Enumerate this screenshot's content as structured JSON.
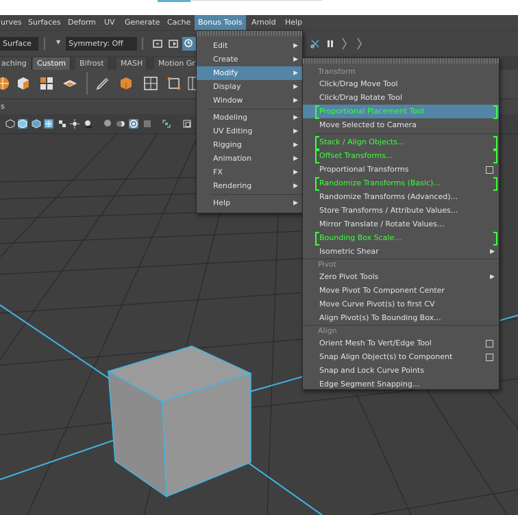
{
  "menubar": {
    "items": [
      "urves",
      "Surfaces",
      "Deform",
      "UV",
      "Generate",
      "Cache",
      "Bonus Tools",
      "Arnold",
      "Help"
    ],
    "active": "Bonus Tools"
  },
  "toolbar": {
    "surface_label": "Surface",
    "symmetry_label": "Symmetry: Off"
  },
  "shelf_tabs": [
    "aching",
    "Custom",
    "Bifrost",
    "MASH",
    "Motion Gr"
  ],
  "panel_label": "ls",
  "bonus_menu": {
    "items": [
      {
        "label": "Edit",
        "submenu": true
      },
      {
        "label": "Create",
        "submenu": true
      },
      {
        "label": "Modify",
        "submenu": true,
        "selected": true
      },
      {
        "label": "Display",
        "submenu": true
      },
      {
        "label": "Window",
        "submenu": true
      },
      {
        "label": "Modeling",
        "submenu": true
      },
      {
        "label": "UV Editing",
        "submenu": true
      },
      {
        "label": "Rigging",
        "submenu": true
      },
      {
        "label": "Animation",
        "submenu": true
      },
      {
        "label": "FX",
        "submenu": true
      },
      {
        "label": "Rendering",
        "submenu": true
      },
      {
        "label": "Help",
        "submenu": true
      }
    ]
  },
  "modify_menu": {
    "sections": {
      "transform": "Transform",
      "pivot": "Pivot",
      "align": "Align"
    },
    "transform_items": [
      {
        "label": "Click/Drag Move Tool"
      },
      {
        "label": "Click/Drag Rotate Tool"
      },
      {
        "label": "Proportional Placement Tool",
        "marked": true,
        "highlighted": true
      },
      {
        "label": "Move Selected to Camera"
      },
      {
        "label": "Stack / Align Objects...",
        "marked": true
      },
      {
        "label": "Offset Transforms...",
        "marked": true
      },
      {
        "label": "Proportional Transforms",
        "option_box": true
      },
      {
        "label": "Randomize Transforms (Basic)...",
        "marked": true
      },
      {
        "label": "Randomize Transforms (Advanced)..."
      },
      {
        "label": "Store Transforms / Attribute Values..."
      },
      {
        "label": "Mirror Translate / Rotate Values..."
      },
      {
        "label": "Bounding Box Scale...",
        "marked": true
      },
      {
        "label": "Isometric Shear",
        "submenu": true
      }
    ],
    "pivot_items": [
      {
        "label": "Zero Pivot Tools",
        "submenu": true
      },
      {
        "label": "Move Pivot To Component Center"
      },
      {
        "label": "Move Curve Pivot(s) to first CV"
      },
      {
        "label": "Align Pivot(s) To Bounding Box..."
      }
    ],
    "align_items": [
      {
        "label": "Orient Mesh To Vert/Edge Tool",
        "option_box": true
      },
      {
        "label": "Snap Align Object(s) to Component",
        "option_box": true
      },
      {
        "label": "Snap and Lock Curve Points"
      },
      {
        "label": "Edge Segment Snapping..."
      }
    ]
  },
  "colors": {
    "menu_bg": "#525252",
    "selection": "#5285a6",
    "marker_green": "#3cff3c",
    "cube_wire": "#3fb6e6"
  }
}
